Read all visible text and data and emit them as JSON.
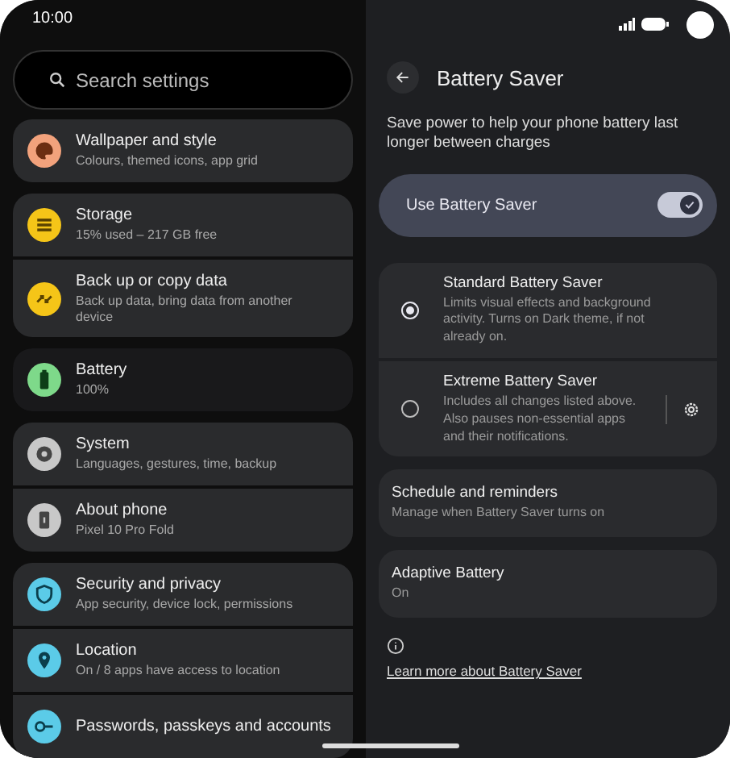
{
  "status_bar": {
    "time": "10:00"
  },
  "sidebar": {
    "search": {
      "placeholder": "Search settings"
    },
    "groups": [
      {
        "items": [
          {
            "kind": "palette",
            "title": "Wallpaper and style",
            "subtitle": "Colours, themed icons, app grid",
            "color": "#f2a27c",
            "selected": false
          }
        ]
      },
      {
        "items": [
          {
            "kind": "storage",
            "title": "Storage",
            "subtitle": "15% used – 217 GB free",
            "color": "#f5c518",
            "selected": false
          },
          {
            "kind": "backup",
            "title": "Back up or copy data",
            "subtitle": "Back up data, bring data from another device",
            "color": "#f5c518",
            "selected": false
          }
        ]
      },
      {
        "items": [
          {
            "kind": "battery",
            "title": "Battery",
            "subtitle": "100%",
            "color": "#7ed98a",
            "selected": true
          }
        ]
      },
      {
        "items": [
          {
            "kind": "gear",
            "title": "System",
            "subtitle": "Languages, gestures, time, backup",
            "color": "#c8c8c8",
            "selected": false
          },
          {
            "kind": "phone",
            "title": "About phone",
            "subtitle": "Pixel 10 Pro Fold",
            "color": "#c8c8c8",
            "selected": false
          }
        ]
      },
      {
        "items": [
          {
            "kind": "shield",
            "title": "Security and privacy",
            "subtitle": "App security, device lock, permissions",
            "color": "#5bcbe8",
            "selected": false
          },
          {
            "kind": "pin",
            "title": "Location",
            "subtitle": "On / 8 apps have access to location",
            "color": "#5bcbe8",
            "selected": false
          },
          {
            "kind": "key",
            "title": "Passwords, passkeys and accounts",
            "color": "#5bcbe8",
            "selected": false
          }
        ]
      }
    ]
  },
  "page": {
    "title": "Battery Saver",
    "description": "Save power to help your phone battery last longer between charges",
    "main_toggle": {
      "label": "Use Battery Saver",
      "on": true
    },
    "modes": [
      {
        "title": "Standard Battery Saver",
        "subtitle": "Limits visual effects and background activity. Turns on Dark theme, if not already on.",
        "selected": true,
        "has_settings": false
      },
      {
        "title": "Extreme Battery Saver",
        "subtitle": "Includes all changes listed above. Also pauses non-essential apps and their notifications.",
        "selected": false,
        "has_settings": true
      }
    ],
    "settings": [
      {
        "title": "Schedule and reminders",
        "subtitle": "Manage when Battery Saver turns on"
      },
      {
        "title": "Adaptive Battery",
        "subtitle": "On"
      }
    ],
    "link": "Learn more about Battery Saver"
  }
}
